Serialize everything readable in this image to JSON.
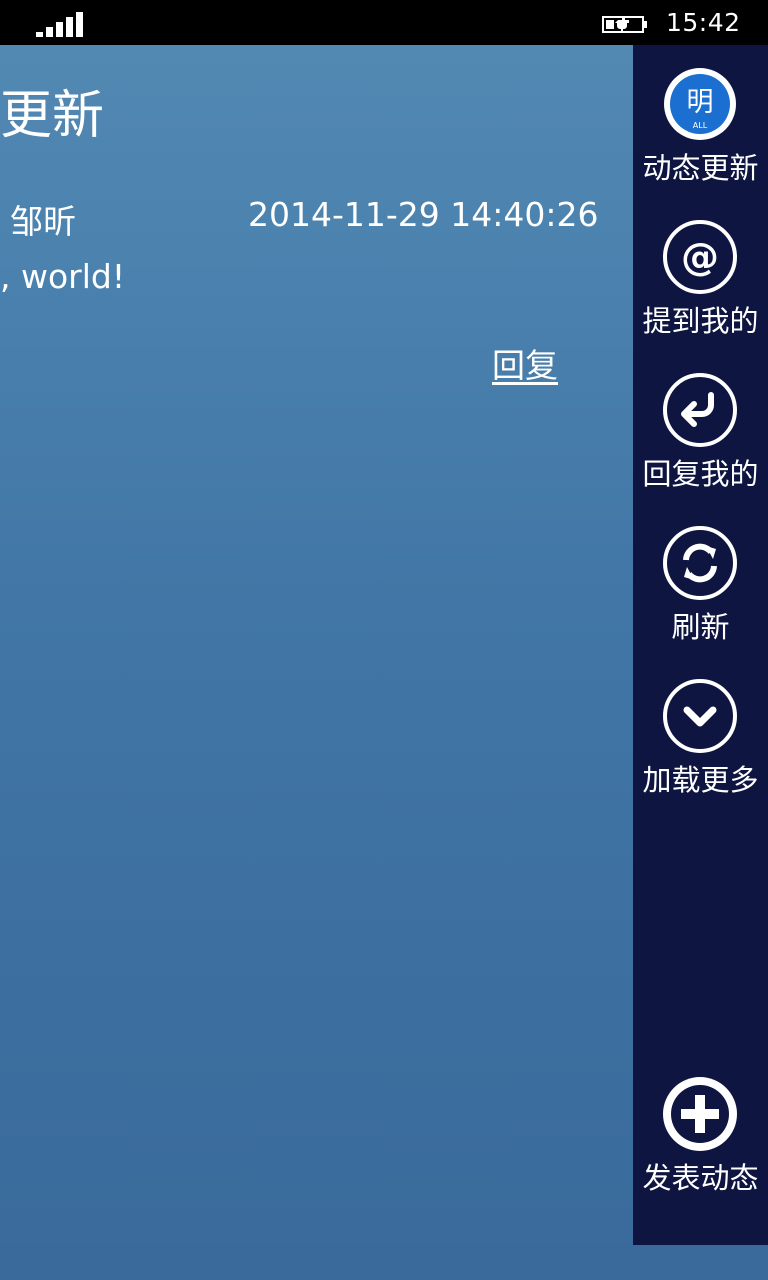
{
  "status_bar": {
    "time": "15:42"
  },
  "page": {
    "title": "更新"
  },
  "post": {
    "author": "邹昕",
    "timestamp": "2014-11-29 14:40:26",
    "body": ", world!",
    "reply_label": "回复"
  },
  "side_menu": {
    "all_badge": "明",
    "all_badge_sub": "ALL",
    "items": [
      {
        "label": "动态更新",
        "icon": "all-updates-icon"
      },
      {
        "label": "提到我的",
        "icon": "at-icon"
      },
      {
        "label": "回复我的",
        "icon": "reply-arrow-icon"
      },
      {
        "label": "刷新",
        "icon": "refresh-icon"
      },
      {
        "label": "加载更多",
        "icon": "chevron-down-icon"
      },
      {
        "label": "发表动态",
        "icon": "plus-circle-icon"
      }
    ]
  },
  "colors": {
    "content_gradient_top": "#5289b3",
    "content_gradient_bottom": "#396a9b",
    "side_menu_bg": "#0e1540",
    "badge_blue": "#1b6fd0"
  }
}
